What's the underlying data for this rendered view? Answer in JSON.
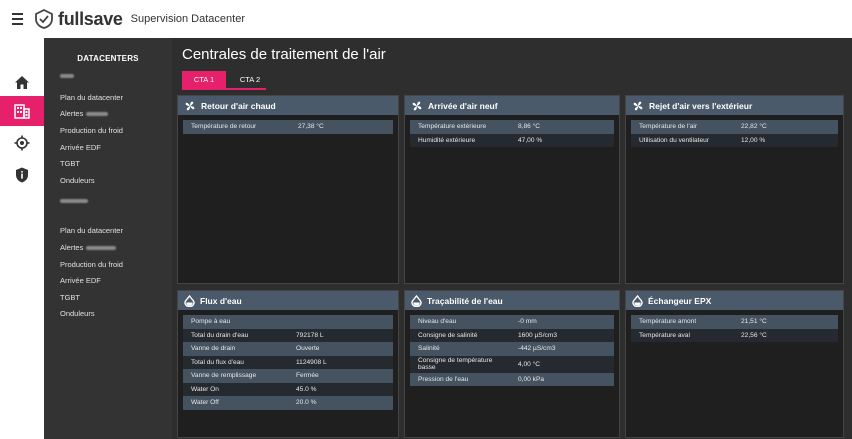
{
  "topbar": {
    "brand": "fullsave",
    "title": "Supervision Datacenter"
  },
  "rail": {
    "items": [
      {
        "icon": "home-icon",
        "active": false
      },
      {
        "icon": "building-icon",
        "active": true
      },
      {
        "icon": "target-icon",
        "active": false
      },
      {
        "icon": "shield-icon",
        "active": false
      }
    ]
  },
  "sidebar": {
    "title": "DATACENTERS",
    "group1": {
      "items": [
        "Plan du datacenter",
        "Alertes",
        "Production du froid",
        "Arrivée EDF",
        "TGBT",
        "Onduleurs"
      ]
    },
    "group2": {
      "items": [
        "Plan du datacenter",
        "Alertes",
        "Production du froid",
        "Arrivée EDF",
        "TGBT",
        "Onduleurs"
      ]
    }
  },
  "main": {
    "title": "Centrales de traitement de l'air",
    "tabs": [
      {
        "label": "CTA 1",
        "active": true
      },
      {
        "label": "CTA 2",
        "active": false
      }
    ]
  },
  "panels": {
    "retour": {
      "title": "Retour d'air chaud",
      "rows": [
        {
          "label": "Température de retour",
          "value": "27,38 °C"
        }
      ]
    },
    "arrivee": {
      "title": "Arrivée d'air neuf",
      "rows": [
        {
          "label": "Température extérieure",
          "value": "8,86 °C"
        },
        {
          "label": "Humidité extérieure",
          "value": "47,00 %"
        }
      ]
    },
    "rejet": {
      "title": "Rejet d'air vers l'extérieur",
      "rows": [
        {
          "label": "Température de l'air",
          "value": "22,82 °C"
        },
        {
          "label": "Utilisation du ventilateur",
          "value": "12,00 %"
        }
      ]
    },
    "flux": {
      "title": "Flux d'eau",
      "rows": [
        {
          "label": "Pompe à eau",
          "value": ""
        },
        {
          "label": "Total du drain d'eau",
          "value": "792178 L"
        },
        {
          "label": "Vanne de drain",
          "value": "Ouverte"
        },
        {
          "label": "Total du flux d'eau",
          "value": "1124908 L"
        },
        {
          "label": "Vanne de remplissage",
          "value": "Fermée"
        },
        {
          "label": "Water On",
          "value": "45.0 %"
        },
        {
          "label": "Water Off",
          "value": "20.0 %"
        }
      ]
    },
    "tracabilite": {
      "title": "Traçabilité de l'eau",
      "rows": [
        {
          "label": "Niveau d'eau",
          "value": "-0 mm"
        },
        {
          "label": "Consigne de salinité",
          "value": "1600 µS/cm3"
        },
        {
          "label": "Salinité",
          "value": "-442 µS/cm3"
        },
        {
          "label": "Consigne de température basse",
          "value": "4,00 °C"
        },
        {
          "label": "Pression de l'eau",
          "value": "0,00 kPa"
        }
      ]
    },
    "echangeur": {
      "title": "Échangeur EPX",
      "rows": [
        {
          "label": "Température amont",
          "value": "21,51 °C"
        },
        {
          "label": "Température aval",
          "value": "22,56 °C"
        }
      ]
    }
  },
  "colors": {
    "accent": "#e6206a",
    "panel_header": "#4a5a6a",
    "background": "#2e2e2e"
  }
}
